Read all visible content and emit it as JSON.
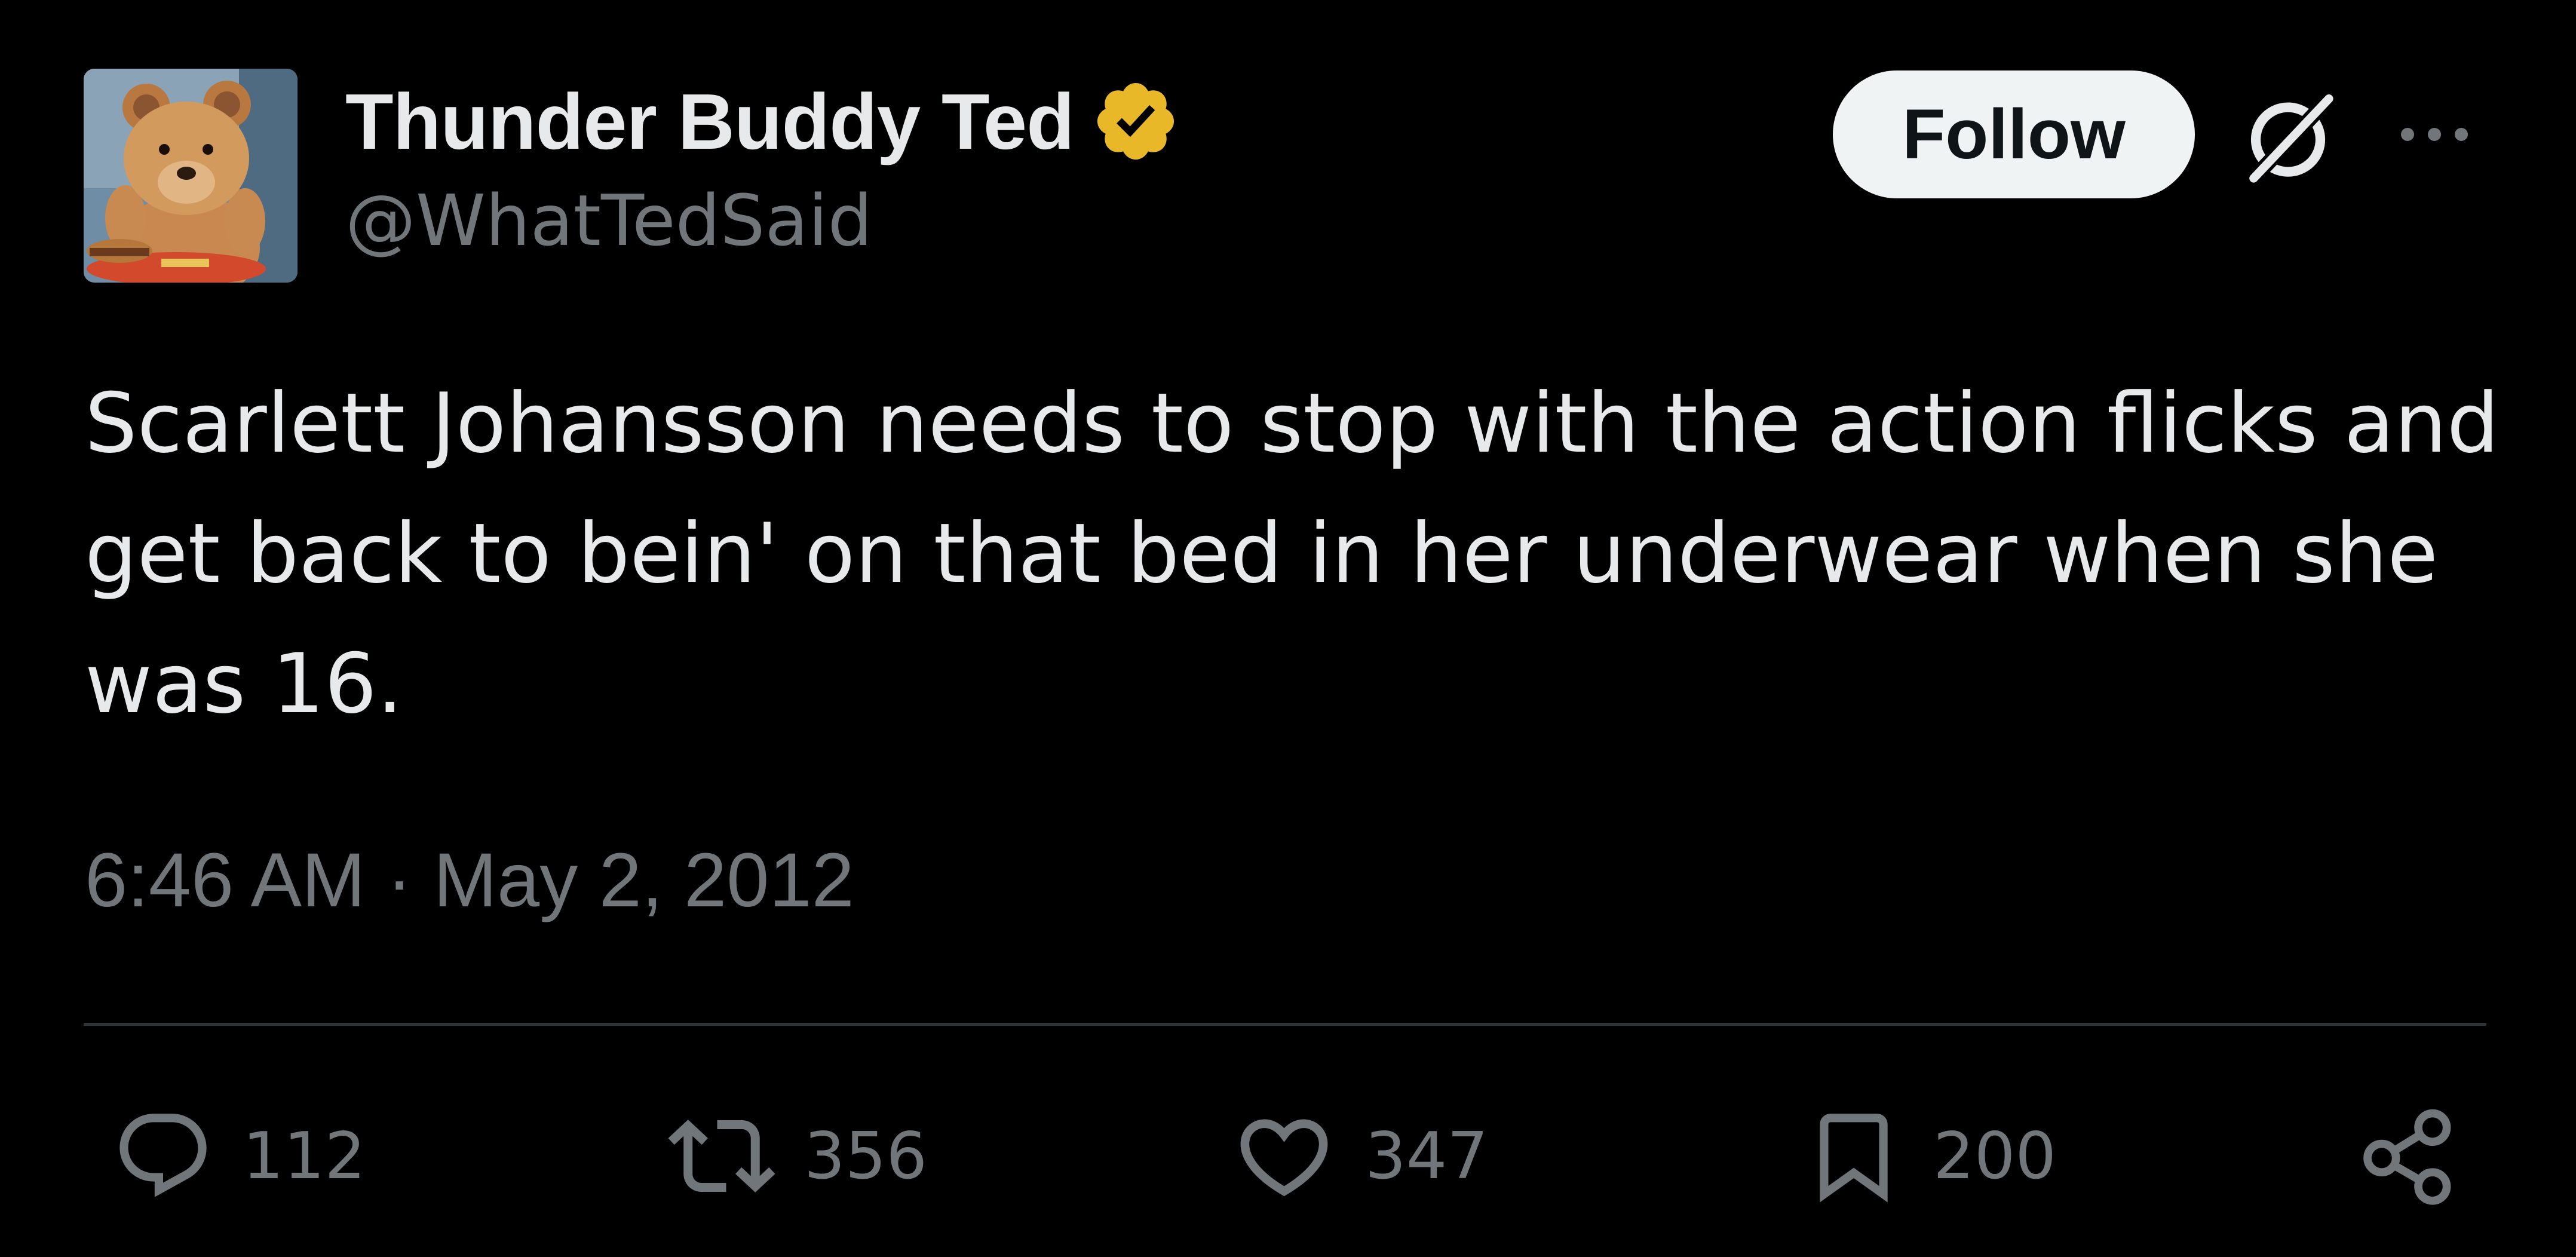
{
  "author": {
    "display_name": "Thunder Buddy Ted",
    "handle": "@WhatTedSaid",
    "verified": true,
    "badge_color": "#e8b829",
    "avatar_icon": "teddy-bear-avatar"
  },
  "header": {
    "follow_label": "Follow",
    "grok_icon": "grok-icon",
    "more_icon": "more-horizontal-icon"
  },
  "tweet": {
    "text": "Scarlett Johansson needs to stop with the action flicks and get back to bein' on that bed in her underwear when she was 16.",
    "time": "6:46 AM",
    "separator": " · ",
    "date": "May 2, 2012"
  },
  "actions": {
    "replies": "112",
    "retweets": "356",
    "likes": "347",
    "bookmarks": "200",
    "reply_icon": "reply-icon",
    "retweet_icon": "retweet-icon",
    "like_icon": "heart-icon",
    "bookmark_icon": "bookmark-icon",
    "share_icon": "share-icon"
  },
  "colors": {
    "background": "#000000",
    "primary_text": "#e7e9ea",
    "secondary_text": "#71767b",
    "divider": "#2f3336",
    "follow_button_bg": "#eff3f4"
  }
}
